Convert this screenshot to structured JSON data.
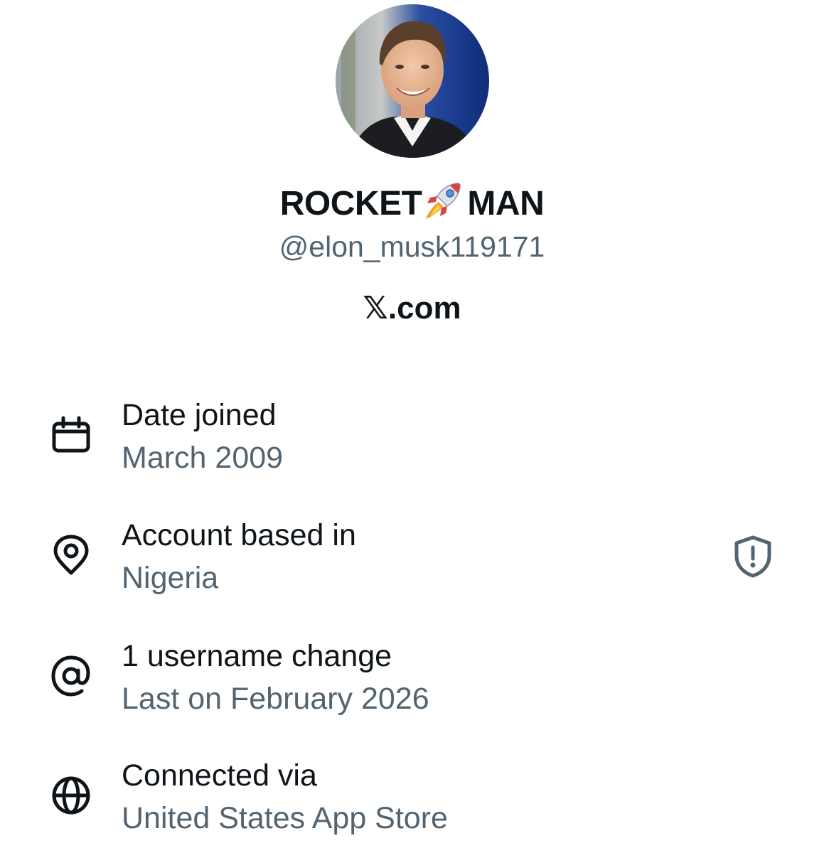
{
  "profile": {
    "name_part1": "ROCKET",
    "name_part2": "MAN",
    "rocket_icon": "rocket-emoji",
    "handle": "@elon_musk119171",
    "website": "𝕏.com"
  },
  "about": [
    {
      "icon": "calendar-icon",
      "title": "Date joined",
      "value": "March 2009"
    },
    {
      "icon": "location-pin-icon",
      "title": "Account based in",
      "value": "Nigeria"
    },
    {
      "icon": "at-sign-icon",
      "title": "1 username change",
      "value": "Last on February 2026"
    },
    {
      "icon": "globe-icon",
      "title": "Connected via",
      "value": "United States App Store"
    }
  ],
  "colors": {
    "text_primary": "#0f1419",
    "text_secondary": "#536471",
    "background": "#ffffff"
  }
}
